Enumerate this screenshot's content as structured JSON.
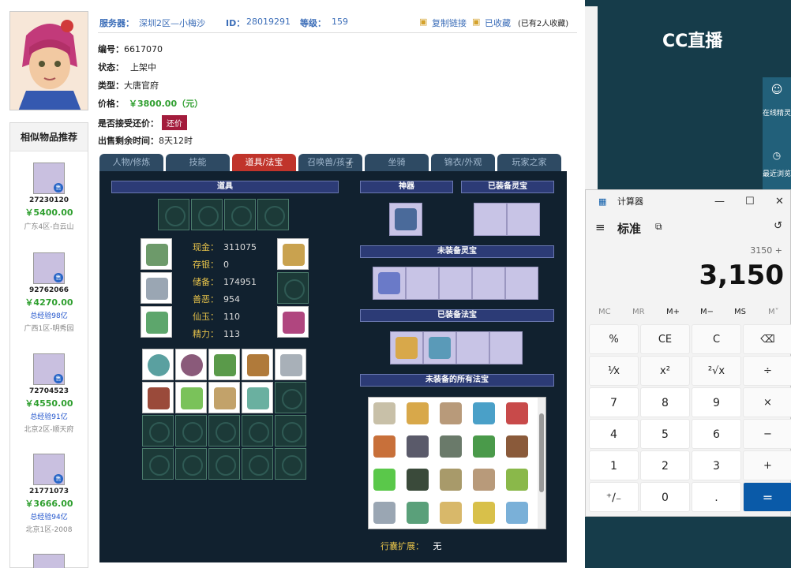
{
  "header": {
    "server_label": "服务器：",
    "server_value": "深圳2区—小梅沙",
    "id_label": "ID：",
    "id_value": "28019291",
    "level_label": "等级：",
    "level_value": "159",
    "copy_link": "复制链接",
    "favorited": "已收藏",
    "fav_count": "(已有2人收藏)"
  },
  "info": {
    "number_label": "编号：",
    "number_value": "6617070",
    "status_label": "状态：",
    "status_value": "上架中",
    "type_label": "类型：",
    "type_value": "大唐官府",
    "price_label": "价格：",
    "price_value": "￥3800.00（元）",
    "counter_label": "是否接受还价：",
    "counter_button": "还价",
    "time_label": "出售剩余时间：",
    "time_value": "8天12时"
  },
  "sidebar": {
    "title": "相似物品推荐",
    "items": [
      {
        "id": "27230120",
        "price": "￥5400.00",
        "exp": "",
        "server": "广东4区-白云山"
      },
      {
        "id": "92762066",
        "price": "￥4270.00",
        "exp": "总经验98亿",
        "server": "广西1区-明秀园"
      },
      {
        "id": "72704523",
        "price": "￥4550.00",
        "exp": "总经验91亿",
        "server": "北京2区-顺天府"
      },
      {
        "id": "21771073",
        "price": "￥3666.00",
        "exp": "总经验94亿",
        "server": "北京1区-2008"
      }
    ],
    "badge": "售"
  },
  "tabs": [
    "人物/修炼",
    "技能",
    "道具/法宝",
    "召唤兽/孩子",
    "坐骑",
    "锦衣/外观",
    "玩家之家"
  ],
  "panel": {
    "props_title": "道具",
    "artifact_title": "神器",
    "equipped_spirit_title": "已装备灵宝",
    "unequipped_spirit_title": "未装备灵宝",
    "equipped_fabao_title": "已装备法宝",
    "unequipped_fabao_title": "未装备的所有法宝",
    "stats": [
      {
        "k": "现金：",
        "v": "311075"
      },
      {
        "k": "存银：",
        "v": "0"
      },
      {
        "k": "储备：",
        "v": "174951"
      },
      {
        "k": "善恶：",
        "v": "954"
      },
      {
        "k": "仙玉：",
        "v": "110"
      },
      {
        "k": "精力：",
        "v": "113"
      }
    ],
    "bag_ext_label": "行囊扩展：",
    "bag_ext_value": "无"
  },
  "cc": {
    "logo": "CC直播",
    "side1": "在线精灵",
    "side2": "最近浏览"
  },
  "calculator": {
    "title": "计算器",
    "mode": "标准",
    "expression": "3150 +",
    "display": "3,150",
    "memory": [
      "MC",
      "MR",
      "M+",
      "M−",
      "MS",
      "M˅"
    ],
    "keys": [
      "%",
      "CE",
      "C",
      "⌫",
      "¹⁄x",
      "x²",
      "²√x",
      "÷",
      "7",
      "8",
      "9",
      "×",
      "4",
      "5",
      "6",
      "−",
      "1",
      "2",
      "3",
      "+",
      "⁺∕₋",
      "0",
      ".",
      "="
    ]
  },
  "colors": {
    "accent_red": "#c0342b",
    "price_green": "#2f9f2f",
    "link_blue": "#3b6db8",
    "panel_bg": "#11212f"
  }
}
